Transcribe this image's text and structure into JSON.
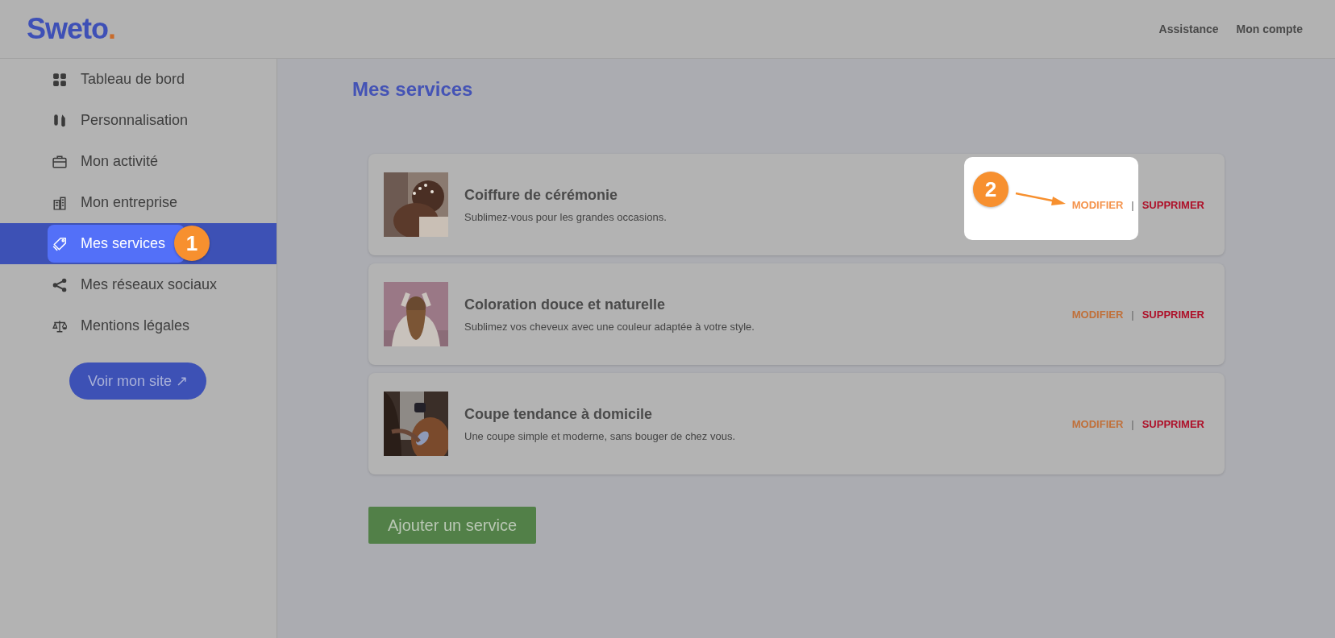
{
  "header": {
    "logo": "Sweto",
    "logo_dot": ".",
    "links": [
      "Assistance",
      "Mon compte"
    ]
  },
  "sidebar": {
    "items": [
      {
        "label": "Tableau de bord",
        "selected": false
      },
      {
        "label": "Personnalisation",
        "selected": false
      },
      {
        "label": "Mon activité",
        "selected": false
      },
      {
        "label": "Mon entreprise",
        "selected": false
      },
      {
        "label": "Mes services",
        "selected": true,
        "callout": "1"
      },
      {
        "label": "Mes réseaux sociaux",
        "selected": false
      },
      {
        "label": "Mentions légales",
        "selected": false
      }
    ],
    "site_button": "Voir mon site ↗"
  },
  "page_title": "Mes services",
  "services": [
    {
      "title": "Coiffure de cérémonie",
      "description": "Sublimez-vous pour les grandes occasions.",
      "edit": "MODIFIER",
      "separator": "|",
      "delete": "SUPPRIMER",
      "highlighted": true,
      "callout": "2"
    },
    {
      "title": "Coloration douce et naturelle",
      "description": "Sublimez vos cheveux avec une couleur adaptée à votre style.",
      "edit": "MODIFIER",
      "separator": "|",
      "delete": "SUPPRIMER",
      "highlighted": false
    },
    {
      "title": "Coupe tendance à domicile",
      "description": "Une coupe simple et moderne, sans bouger de chez vous.",
      "edit": "MODIFIER",
      "separator": "|",
      "delete": "SUPPRIMER",
      "highlighted": false
    }
  ],
  "add_button": "Ajouter un service"
}
